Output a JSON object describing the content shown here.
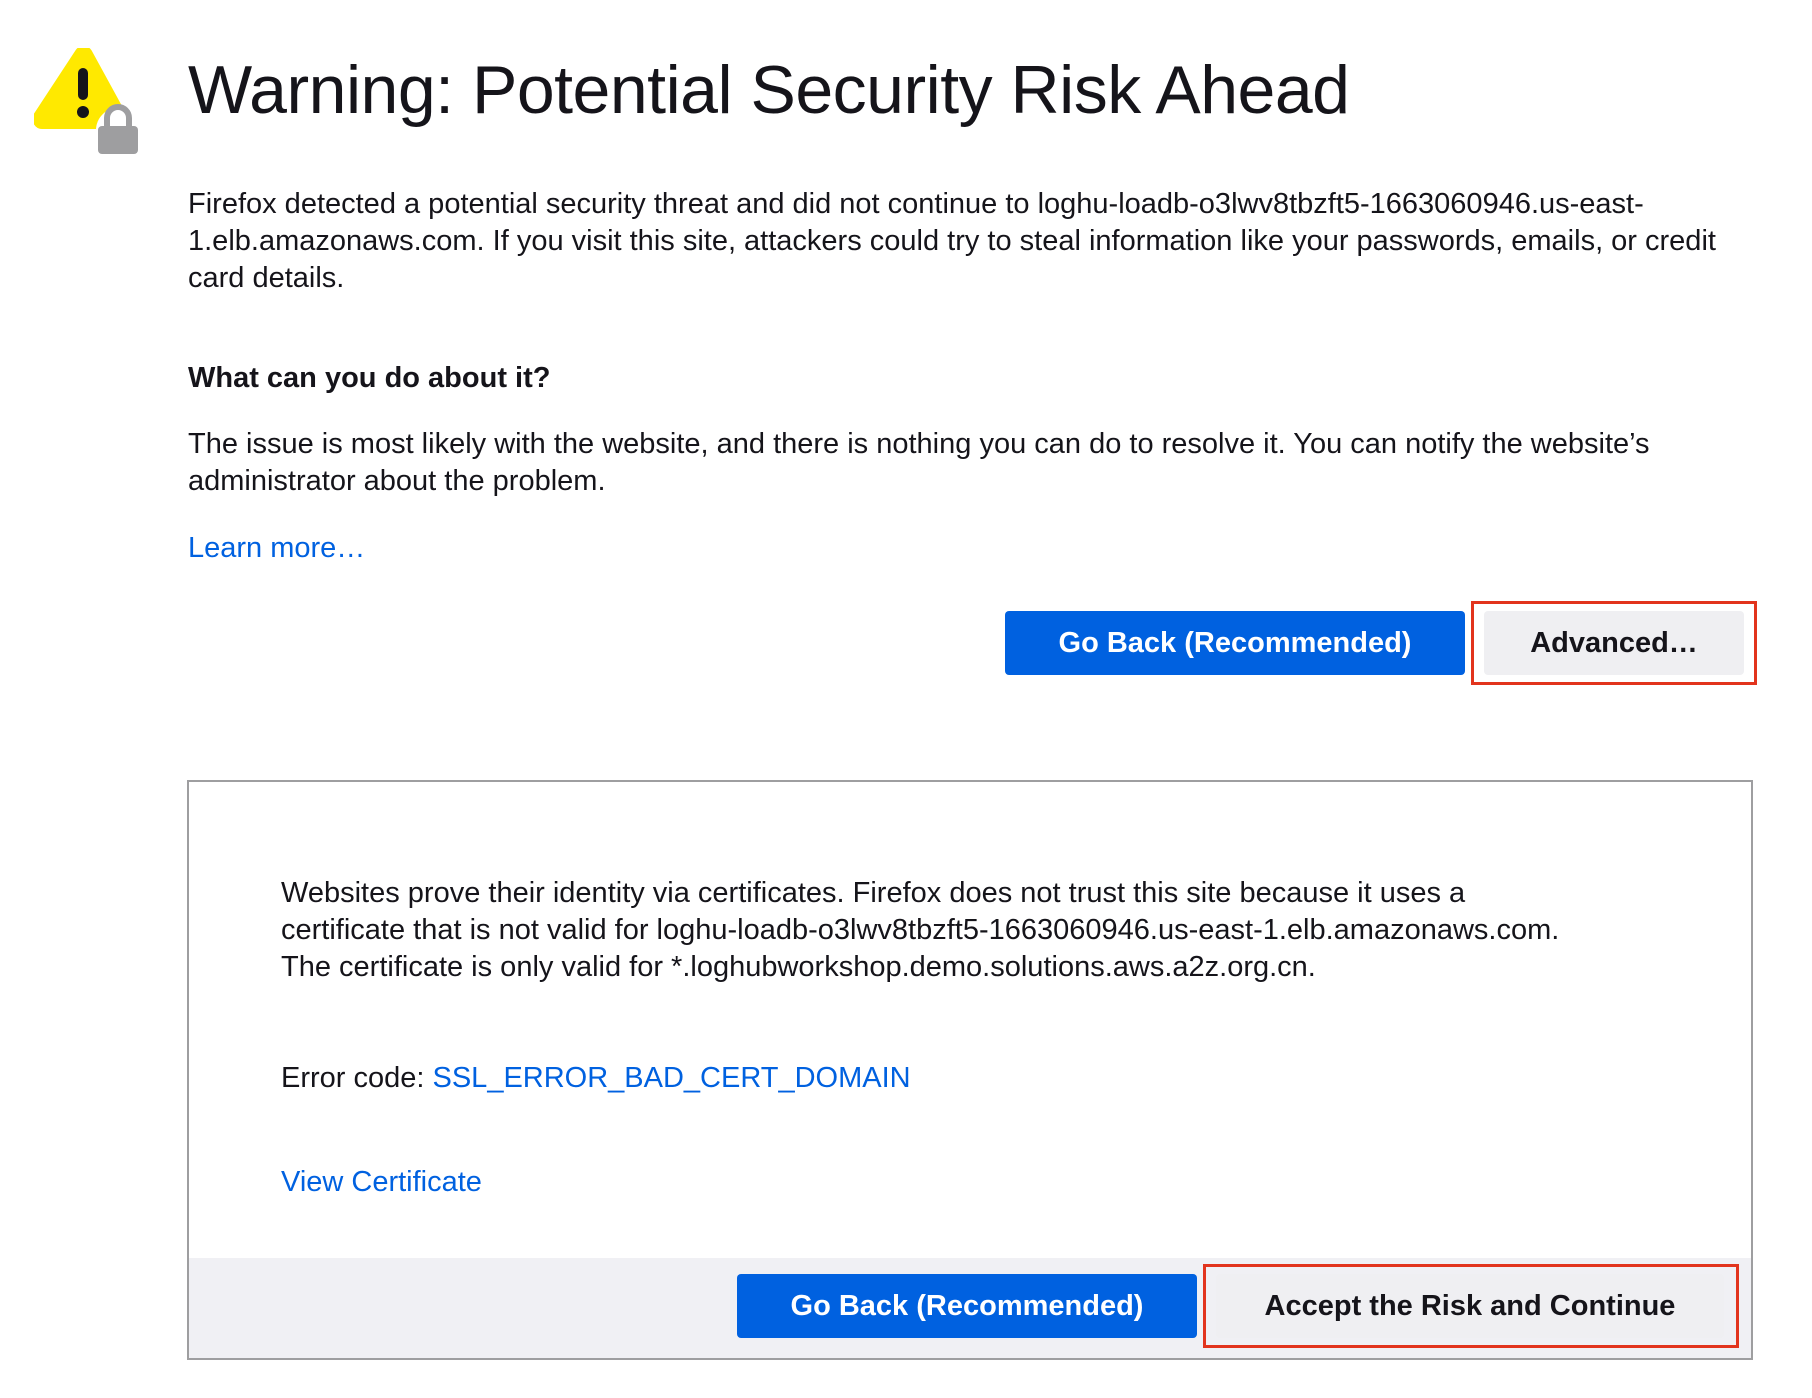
{
  "page": {
    "title": "Warning: Potential Security Risk Ahead",
    "intro": "Firefox detected a potential security threat and did not continue to loghu-loadb-o3lwv8tbzft5-1663060946.us-east-1.elb.amazonaws.com. If you visit this site, attackers could try to steal information like your passwords, emails, or credit card details.",
    "subheading": "What can you do about it?",
    "issue_text": "The issue is most likely with the website, and there is nothing you can do to resolve it. You can notify the website’s administrator about the problem.",
    "learn_more": "Learn more…"
  },
  "buttons": {
    "go_back": "Go Back (Recommended)",
    "advanced": "Advanced…",
    "accept": "Accept the Risk and Continue"
  },
  "advanced_panel": {
    "description": "Websites prove their identity via certificates. Firefox does not trust this site because it uses a certificate that is not valid for loghu-loadb-o3lwv8tbzft5-1663060946.us-east-1.elb.amazonaws.com. The certificate is only valid for *.loghubworkshop.demo.solutions.aws.a2z.org.cn.",
    "error_label": "Error code: ",
    "error_code": "SSL_ERROR_BAD_CERT_DOMAIN",
    "view_certificate": "View Certificate"
  },
  "icons": {
    "warning": "warning-lock-icon"
  },
  "colors": {
    "primary": "#0061e0",
    "secondary_bg": "#efeff2",
    "highlight": "#e2341d",
    "warning_yellow": "#ffe900"
  }
}
